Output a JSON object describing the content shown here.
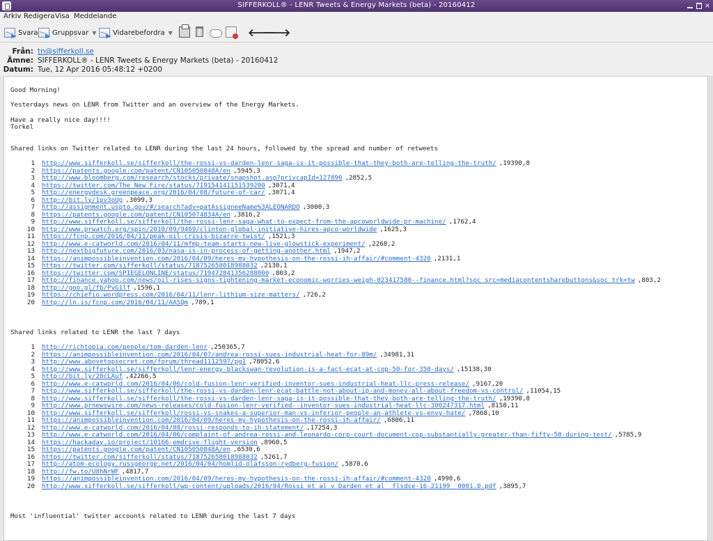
{
  "window": {
    "title": "SIFFERKOLL® - LENR Tweets & Energy Markets (beta) - 20160412",
    "close_glyph": "×"
  },
  "menu": [
    "Arkiv",
    "Redigera",
    "Visa",
    "Meddelande"
  ],
  "toolbar": {
    "reply": "Svara",
    "reply_all": "Gruppsvar",
    "forward": "Vidarebefordra",
    "icons": [
      "printer-icon",
      "trash-icon",
      "cloud-icon",
      "junk-tag-icon"
    ],
    "back_glyph": "🡐",
    "forward_glyph": "🡒"
  },
  "header": {
    "from_label": "Från:",
    "from": "tn@sifferkoll.se",
    "subject_label": "Ämne:",
    "subject": "SIFFERKOLL® - LENR Tweets & Energy Markets (beta) - 20160412",
    "date_label": "Datum:",
    "date": "Tue, 12 Apr 2016 05:48:12 +0200"
  },
  "body": {
    "greeting": "Good Morning!",
    "intro": "Yesterdays news on LENR from Twitter and an overview of the Energy Markets.",
    "wish": "Have a really nice day!!!!",
    "signature": "Torkel",
    "section1_title": "Shared links on Twitter related to LENR during the last 24 hours, followed by the spread and number of retweets",
    "section2_title": "Shared links related to LENR the last 7 days",
    "section3_title": "Most 'influential' twitter accounts related to LENR during the last 7 days",
    "links_24h": [
      {
        "n": "1",
        "url": "http://www.sifferkoll.se/sifferkoll/the-rossi-vs-darden-lenr-saga-is-it-possible-that-they-both-are-telling-the-truth/",
        "stats": ",19390,8"
      },
      {
        "n": "2",
        "url": "https://patents.google.com/patent/CN105050848A/en",
        "stats": ",5945,3"
      },
      {
        "n": "3",
        "url": "http://www.bloomberg.com/research/stocks/private/snapshot.asp?privcapId=127890",
        "stats": ",2852,5"
      },
      {
        "n": "4",
        "url": "https://twitter.com/The_New_Fire/status/719154141151539200",
        "stats": ",3071,4"
      },
      {
        "n": "5",
        "url": "http://energydesk.greenpeace.org/2016/04/08/future-of-car/",
        "stats": ",3071,4"
      },
      {
        "n": "6",
        "url": "http://bit.ly/1pv3oUg",
        "stats": ",3099,3"
      },
      {
        "n": "7",
        "url": "http://assignment.uspto.gov/#/search?adv=patAssigneeName%3ALEONARDO",
        "stats": ",3000,3"
      },
      {
        "n": "8",
        "url": "https://patents.google.com/patent/CN105074834A/en",
        "stats": ",3816,2"
      },
      {
        "n": "9",
        "url": "http://www.sifferkoll.se/sifferkoll/the-rossi-lenr-saga-what-to-expect-from-the-apcoworldwide-pr-machine/",
        "stats": ",1762,4"
      },
      {
        "n": "10",
        "url": "http://www.prwatch.org/spin/2010/09/9469/clinton-global-initiative-hires-apco-worldwide",
        "stats": ",1625,3"
      },
      {
        "n": "11",
        "url": "https://fcnp.com/2016/04/11/peak-oil-crisis-bizarre-twist/",
        "stats": ",1521,3"
      },
      {
        "n": "12",
        "url": "http://www.e-catworld.com/2016/04/11/mfmp-team-starts-new-live-glowstick-experiment/",
        "stats": ",2268,2"
      },
      {
        "n": "13",
        "url": "http://nextbigfuture.com/2016/03/nasa-is-in-process-of-getting-another.html",
        "stats": ",1947,2"
      },
      {
        "n": "14",
        "url": "https://animpossibleinvention.com/2016/04/09/heres-my-hypothesis-on-the-rossi-ih-affair/#comment-4320",
        "stats": ",2131,1"
      },
      {
        "n": "15",
        "url": "https://twitter.com/sifferkoll/status/718752658018988032",
        "stats": ",2130,1"
      },
      {
        "n": "16",
        "url": "https://twitter.com/SPIEGELONLINE/status/719472841356288000",
        "stats": ",803,2"
      },
      {
        "n": "17",
        "url": "http://finance.yahoo.com/news/oil-rises-signs-tightening-market-economic-worries-weigh-023417580--finance.html?soc_src=mediacontentsharebuttons&soc_trk=tw",
        "stats": ",803,2"
      },
      {
        "n": "18",
        "url": "http://goo.gl/fb/PyG1lf",
        "stats": ",1596,1"
      },
      {
        "n": "19",
        "url": "https://chiefio.wordpress.com/2016/04/11/lenr-lithium-size-matters/",
        "stats": ",726,2"
      },
      {
        "n": "20",
        "url": "http://ln.is/fcnp.com/2016/04/11/AASQm",
        "stats": ",789,1"
      }
    ],
    "links_7d": [
      {
        "n": "1",
        "url": "http://richtopia.com/people/tom-darden-lenr",
        "stats": ",250365,7"
      },
      {
        "n": "2",
        "url": "https://animpossibleinvention.com/2016/04/07/andrea-rossi-sues-industrial-heat-for-89m/",
        "stats": ",34981,31"
      },
      {
        "n": "3",
        "url": "http://www.abovetopsecret.com/forum/thread1112597/pg1",
        "stats": ",78052,6"
      },
      {
        "n": "4",
        "url": "http://www.sifferkoll.se/sifferkoll/lenr-energy-blackswan-revolution-is-a-fact-ecat-at-cop-50-for-350-days/",
        "stats": ",15138,30"
      },
      {
        "n": "5",
        "url": "http://bit.ly/20cLAuf",
        "stats": ",42266,5"
      },
      {
        "n": "6",
        "url": "http://www.e-catworld.com/2016/04/06/cold-fusion-lenr-verified-inventor-sues-industrial-heat-llc-press-release/",
        "stats": ",9167,20"
      },
      {
        "n": "7",
        "url": "http://www.sifferkoll.se/sifferkoll/the-rossi-vs-darden-lenr-ecat-battle-not-about-ip-and-money-all-about-freedom-vs-control/",
        "stats": ",11054,15"
      },
      {
        "n": "8",
        "url": "http://www.sifferkoll.se/sifferkoll/the-rossi-vs-darden-lenr-saga-is-it-possible-that-they-both-are-telling-the-truth/",
        "stats": ",19390,8"
      },
      {
        "n": "9",
        "url": "http://www.prnewswire.com/news-releases/cold-fusion-lenr-verified--inventor-sues-industrial-heat-llc-300247317.html",
        "stats": ",8158,11"
      },
      {
        "n": "10",
        "url": "http://www.sifferkoll.se/sifferkoll/rossi-vs-snakes-a-superior-man-vs-inferior-people-an-athlete-vs-envy-hate/",
        "stats": ",7868,10"
      },
      {
        "n": "11",
        "url": "https://animpossibleinvention.com/2016/04/09/heres-my-hypothesis-on-the-rossi-ih-affair/",
        "stats": ",6806,11"
      },
      {
        "n": "12",
        "url": "http://www.e-catworld.com/2016/04/08/rossi-responds-to-ih-statement/",
        "stats": ",17254,3"
      },
      {
        "n": "13",
        "url": "http://www.e-catworld.com/2016/04/06/complaint-of-andrea-rossi-and-leonardo-corp-court-document-cop-substantially-greater-than-fifty-50-during-test/",
        "stats": ",5785,9"
      },
      {
        "n": "14",
        "url": "https://hackaday.io/project/10166-emdrive-flight-version",
        "stats": ",8960,5"
      },
      {
        "n": "15",
        "url": "https://patents.google.com/patent/CN105050848A/en",
        "stats": ",6530,6"
      },
      {
        "n": "16",
        "url": "https://twitter.com/sifferkoll/status/718752658018988032",
        "stats": ",5261,7"
      },
      {
        "n": "17",
        "url": "http://atom-ecology.russgeorge.net/2016/04/04/homlid-olafsson-rydberg-fusion/",
        "stats": ",5870,6"
      },
      {
        "n": "18",
        "url": "http://fw.to/U8hNrWF",
        "stats": ",4817,7"
      },
      {
        "n": "19",
        "url": "https://animpossibleinvention.com/2016/04/09/heres-my-hypothesis-on-the-rossi-ih-affair/#comment-4320",
        "stats": ",4990,6"
      },
      {
        "n": "20",
        "url": "http://www.sifferkoll.se/sifferkoll/wp-content/uploads/2016/04/Rossi_et_al_v_Darden_et_al__flsdce-16-21199__0001.0.pdf",
        "stats": ",3895,7"
      }
    ]
  },
  "colors": {
    "titlebar": "#5a3d7e",
    "link": "#2a6cc7",
    "chrome": "#efefef"
  }
}
